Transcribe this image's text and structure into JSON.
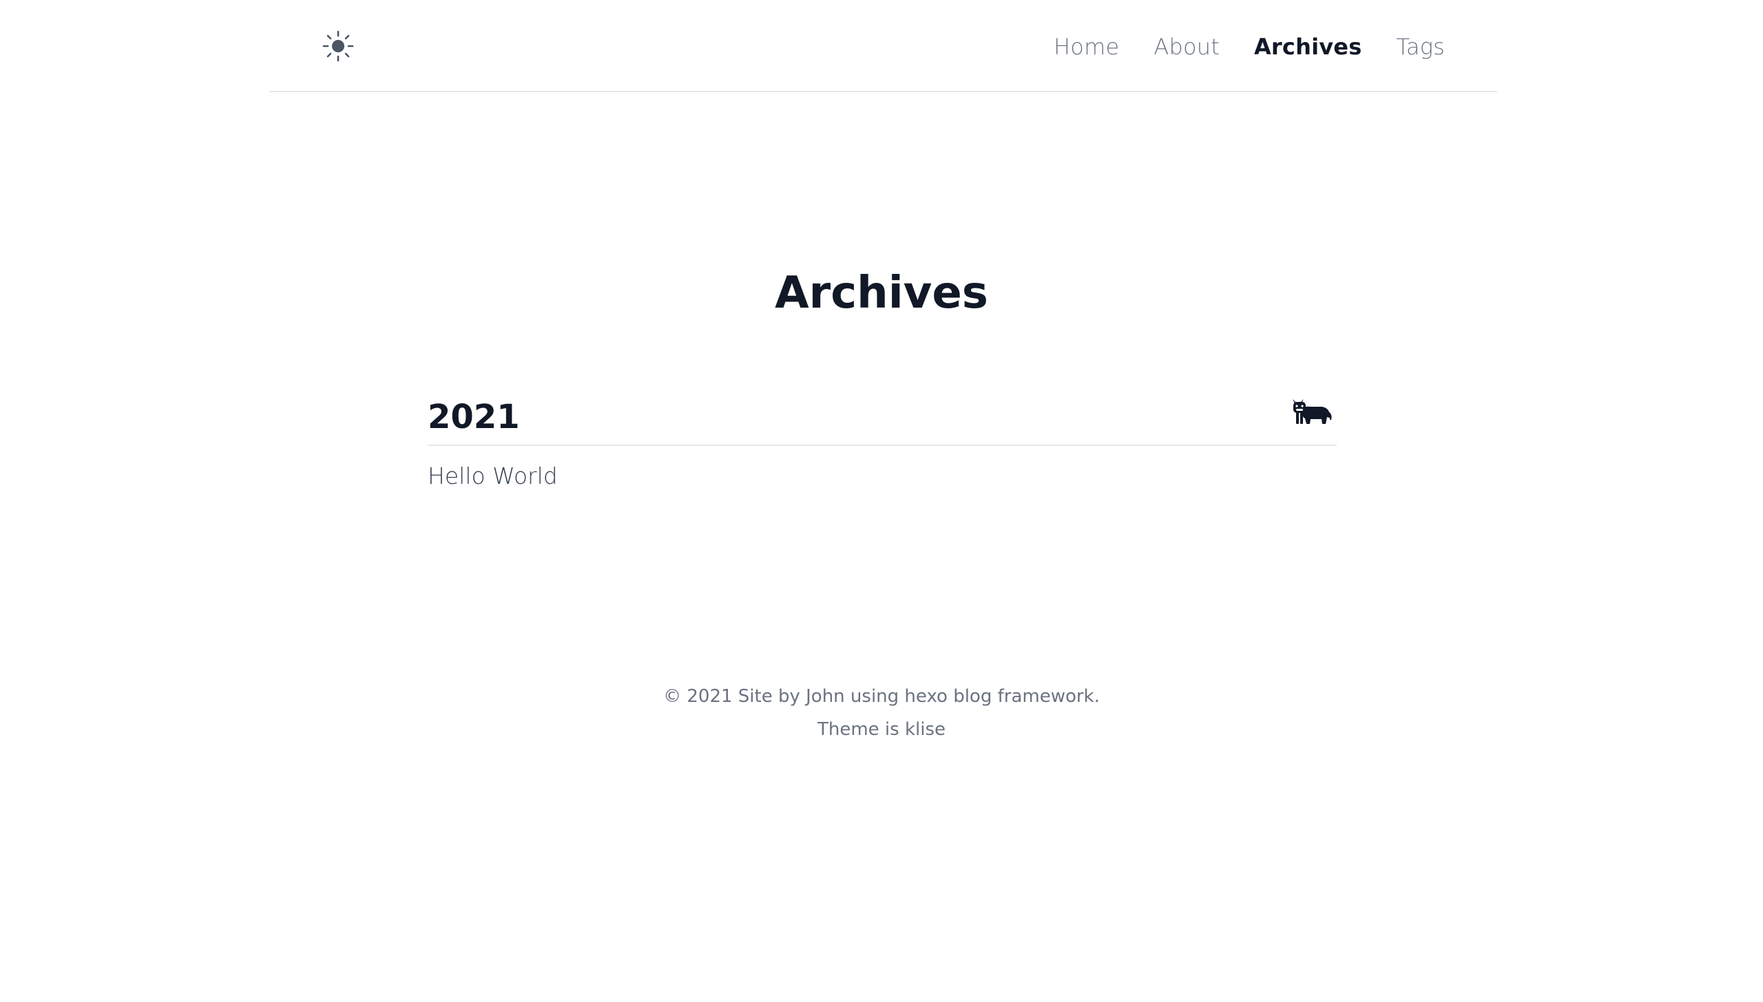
{
  "header": {
    "theme_icon": "sun-icon",
    "nav": [
      {
        "label": "Home",
        "active": false
      },
      {
        "label": "About",
        "active": false
      },
      {
        "label": "Archives",
        "active": true
      },
      {
        "label": "Tags",
        "active": false
      }
    ]
  },
  "main": {
    "title": "Archives",
    "years": [
      {
        "year": "2021",
        "icon": "ox-icon",
        "posts": [
          {
            "title": "Hello World"
          }
        ]
      }
    ]
  },
  "footer": {
    "line1": "© 2021 Site by John using hexo blog framework.",
    "line2": "Theme is klise"
  },
  "colors": {
    "text_primary": "#111827",
    "text_muted": "#6b7280",
    "divider": "#e5e7eb",
    "background": "#ffffff"
  }
}
